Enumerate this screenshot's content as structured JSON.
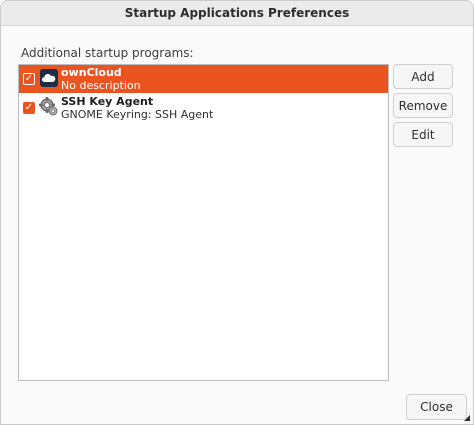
{
  "window": {
    "title": "Startup Applications Preferences"
  },
  "section_label": "Additional startup programs:",
  "programs": [
    {
      "name": "ownCloud",
      "description": "No description",
      "enabled": true,
      "selected": true,
      "icon": "owncloud-icon"
    },
    {
      "name": "SSH Key Agent",
      "description": "GNOME Keyring: SSH Agent",
      "enabled": true,
      "selected": false,
      "icon": "keys-gear-icon"
    }
  ],
  "buttons": {
    "add": "Add",
    "remove": "Remove",
    "edit": "Edit",
    "close": "Close"
  },
  "colors": {
    "accent": "#e95420",
    "owncloud_bg": "#1d2d44"
  }
}
